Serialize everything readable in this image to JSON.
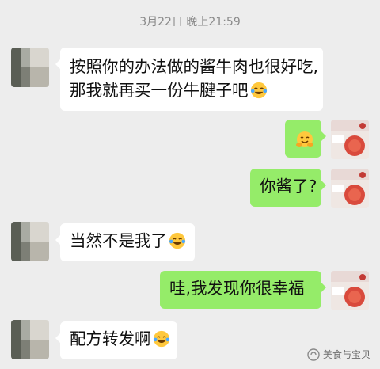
{
  "chat": {
    "timestamp": "3月22日 晚上21:59",
    "messages": [
      {
        "side": "in",
        "lines": [
          "按照你的办法做的酱牛肉也很好吃,",
          "那我就再买一份牛腱子吧"
        ],
        "emoji": "laugh-cry"
      },
      {
        "side": "out",
        "lines": [
          ""
        ],
        "emoji": "hug"
      },
      {
        "side": "out",
        "lines": [
          "你酱了?"
        ],
        "emoji": ""
      },
      {
        "side": "in",
        "lines": [
          "当然不是我了"
        ],
        "emoji": "laugh-cry"
      },
      {
        "side": "out",
        "lines": [
          "哇,我发现你很幸福"
        ],
        "emoji": ""
      },
      {
        "side": "in",
        "lines": [
          "配方转发啊"
        ],
        "emoji": "laugh-cry"
      }
    ]
  },
  "watermark": {
    "text": "美食与宝贝",
    "icon": "wechat-official-account-icon"
  }
}
